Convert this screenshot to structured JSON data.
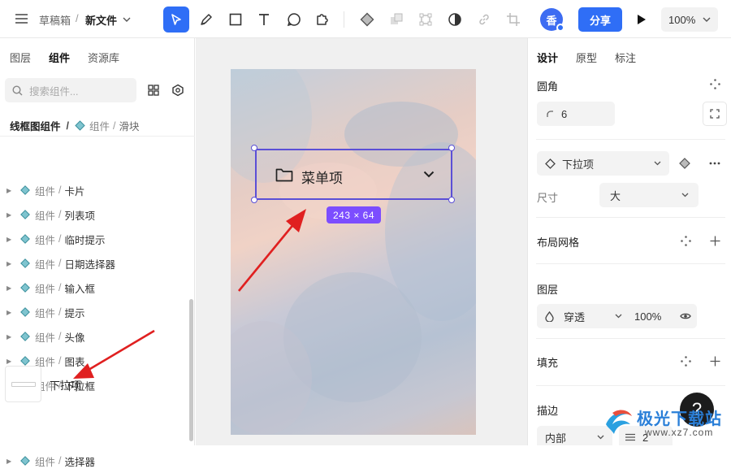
{
  "topbar": {
    "breadcrumb_parent": "草稿箱",
    "breadcrumb_sep": "/",
    "file_name": "新文件",
    "avatar_letter": "香",
    "share_label": "分享",
    "zoom_label": "100%"
  },
  "left_panel": {
    "tabs": [
      "图层",
      "组件",
      "资源库"
    ],
    "active_tab": "组件",
    "search_placeholder": "搜索组件...",
    "section_title": "线框图组件",
    "section_sep": "/",
    "section_sub_prefix": "组件",
    "section_sub_name": "滑块",
    "items": [
      {
        "prefix": "组件",
        "name": "卡片",
        "expanded": false
      },
      {
        "prefix": "组件",
        "name": "列表项",
        "expanded": false
      },
      {
        "prefix": "组件",
        "name": "临时提示",
        "expanded": false
      },
      {
        "prefix": "组件",
        "name": "日期选择器",
        "expanded": false
      },
      {
        "prefix": "组件",
        "name": "输入框",
        "expanded": false
      },
      {
        "prefix": "组件",
        "name": "提示",
        "expanded": false
      },
      {
        "prefix": "组件",
        "name": "头像",
        "expanded": false
      },
      {
        "prefix": "组件",
        "name": "图表",
        "expanded": false
      },
      {
        "prefix": "组件",
        "name": "下拉框",
        "expanded": true
      }
    ],
    "child_item": "下拉项",
    "last_item": {
      "prefix": "组件",
      "name": "选择器",
      "expanded": false
    }
  },
  "canvas": {
    "selected_label": "菜单项",
    "size_badge": "243 × 64"
  },
  "right_panel": {
    "tabs": [
      "设计",
      "原型",
      "标注"
    ],
    "active_tab": "设计",
    "corner_label": "圆角",
    "corner_value": "6",
    "variant_label": "下拉项",
    "size_label": "尺寸",
    "size_value": "大",
    "grid_label": "布局网格",
    "layer_label": "图层",
    "blend_value": "穿透",
    "opacity_value": "100%",
    "fill_label": "填充",
    "stroke_label": "描边",
    "stroke_position": "内部",
    "stroke_width": "2"
  },
  "watermark": {
    "text": "极光下载站",
    "url": "www.xz7.com"
  },
  "colors": {
    "accent": "#2f6ef6",
    "selection": "#7c4dff",
    "arrow": "#e02020"
  }
}
